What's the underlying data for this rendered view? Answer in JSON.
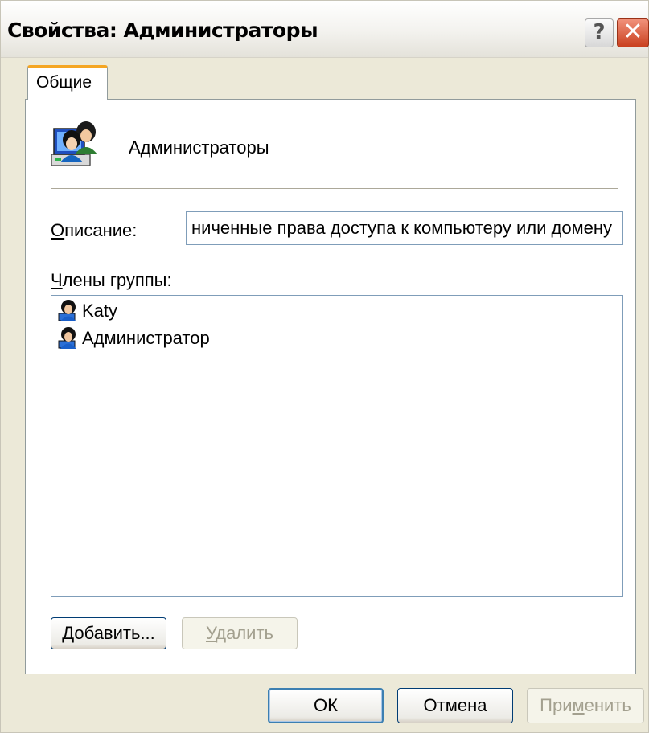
{
  "window": {
    "title": "Свойства: Администраторы"
  },
  "title_buttons": {
    "help": "?",
    "close": "✕"
  },
  "tabs": [
    {
      "label": "Общие",
      "active": true
    }
  ],
  "general": {
    "group_name": "Администраторы",
    "group_icon": "user-group-computer-icon",
    "description_label_accel": "О",
    "description_label_rest": "писание:",
    "description_value": "ниченные права доступа к компьютеру или домену",
    "members_label_accel": "Ч",
    "members_label_rest": "лены группы:",
    "members": [
      {
        "name": "Katy",
        "icon": "user-icon"
      },
      {
        "name": "Администратор",
        "icon": "user-icon"
      }
    ],
    "add_button_accel": "Д",
    "add_button_rest": "обавить...",
    "remove_button_accel": "У",
    "remove_button_rest": "далить"
  },
  "footer": {
    "ok": "ОК",
    "cancel": "Отмена",
    "apply_pre": "При",
    "apply_accel": "м",
    "apply_post": "енить"
  },
  "colors": {
    "dialog_bg": "#ECE9D8",
    "tab_accent": "#F5A623",
    "border_blue": "#7F9DB9",
    "close_red": "#C9401F"
  }
}
